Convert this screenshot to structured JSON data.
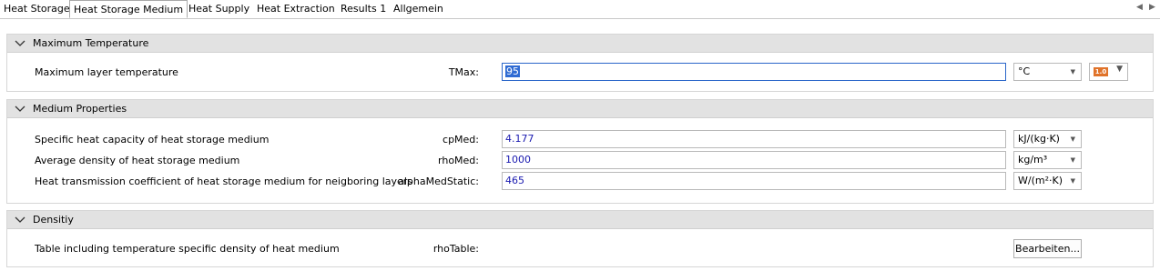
{
  "tabs": [
    {
      "label": "Heat Storage"
    },
    {
      "label": "Heat Storage Medium"
    },
    {
      "label": "Heat Supply"
    },
    {
      "label": "Heat Extraction"
    },
    {
      "label": "Results 1"
    },
    {
      "label": "Allgemein"
    }
  ],
  "active_tab": "Heat Storage Medium",
  "sections": {
    "max_temp": {
      "title": "Maximum Temperature",
      "rows": [
        {
          "label": "Maximum layer temperature",
          "param": "TMax:",
          "value": "95",
          "unit": "°C",
          "extra_badge": "1.0"
        }
      ]
    },
    "medium": {
      "title": "Medium Properties",
      "rows": [
        {
          "label": "Specific heat capacity of heat storage medium",
          "param": "cpMed:",
          "value": "4.177",
          "unit": "kJ/(kg·K)"
        },
        {
          "label": "Average density of heat storage medium",
          "param": "rhoMed:",
          "value": "1000",
          "unit": "kg/m³"
        },
        {
          "label": "Heat transmission coefficient of heat storage medium for neigboring layers",
          "param": "alphaMedStatic:",
          "value": "465",
          "unit": "W/(m²·K)"
        }
      ]
    },
    "density": {
      "title": "Densitiy",
      "rows": [
        {
          "label": "Table including temperature specific density of heat medium",
          "param": "rhoTable:",
          "button": "Bearbeiten..."
        }
      ]
    }
  },
  "icons": {
    "collapse": "chevron-down-icon",
    "dropdown": "dropdown-arrow-icon",
    "tab_prev": "tab-scroll-left-icon",
    "tab_next": "tab-scroll-right-icon"
  },
  "colors": {
    "header_bg": "#e2e2e2",
    "value_text": "#1a1ab0",
    "selection": "#2f6bd3",
    "badge": "#e0732a"
  }
}
